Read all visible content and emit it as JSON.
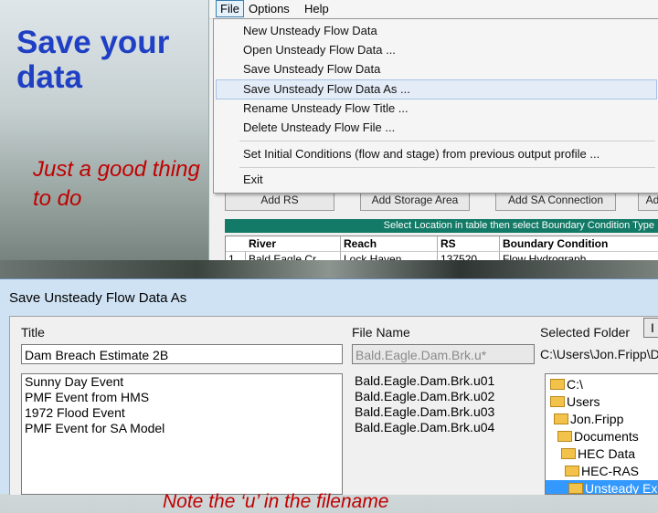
{
  "slide": {
    "title": "Save your data",
    "subtitle": "Just a good thing to do"
  },
  "menubar": {
    "items": [
      "File",
      "Options",
      "Help"
    ]
  },
  "file_menu": {
    "items": [
      "New Unsteady Flow Data",
      "Open Unsteady Flow Data ...",
      "Save Unsteady Flow Data",
      "Save Unsteady Flow Data As ...",
      "Rename Unsteady Flow Title ...",
      "Delete Unsteady Flow File ...",
      "Set Initial Conditions (flow and stage) from previous output profile ...",
      "Exit"
    ]
  },
  "background_editor": {
    "buttons": [
      "Add RS",
      "Add Storage Area",
      "Add SA Connection",
      "Ad"
    ],
    "instruction": "Select Location in table then select Boundary Condition Type",
    "columns": [
      "River",
      "Reach",
      "RS",
      "Boundary Condition"
    ],
    "row": [
      "1",
      "Bald Eagle Cr.",
      "Lock Haven",
      "137520",
      "Flow Hydrograph"
    ]
  },
  "dialog": {
    "title": "Save Unsteady Flow Data As",
    "title_label": "Title",
    "filename_label": "File Name",
    "folder_label": "Selected Folder",
    "title_value": "Dam Breach Estimate 2B",
    "filename_value": "Bald.Eagle.Dam.Brk.u*",
    "folder_value": "C:\\Users\\Jon.Fripp\\D",
    "titles": [
      "Sunny Day Event",
      "PMF Event from HMS",
      "1972 Flood Event",
      "PMF Event for SA Model"
    ],
    "files": [
      "Bald.Eagle.Dam.Brk.u01",
      "Bald.Eagle.Dam.Brk.u02",
      "Bald.Eagle.Dam.Brk.u03",
      "Bald.Eagle.Dam.Brk.u04"
    ],
    "folders": [
      "C:\\",
      "Users",
      "Jon.Fripp",
      "Documents",
      "HEC Data",
      "HEC-RAS",
      "Unsteady Ex"
    ],
    "note": "Note the ‘u’ in the filename",
    "small_button": "I"
  }
}
